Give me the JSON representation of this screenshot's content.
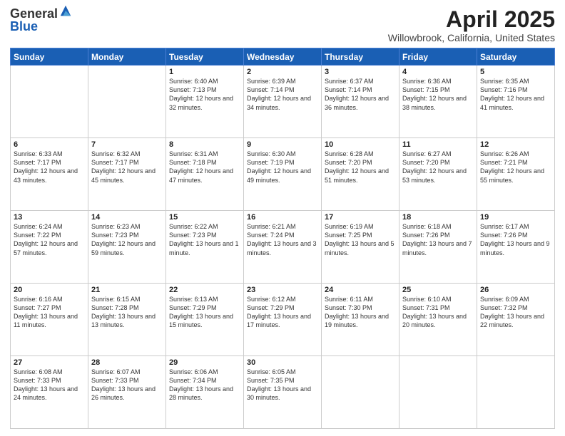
{
  "logo": {
    "general": "General",
    "blue": "Blue"
  },
  "header": {
    "title": "April 2025",
    "subtitle": "Willowbrook, California, United States"
  },
  "weekdays": [
    "Sunday",
    "Monday",
    "Tuesday",
    "Wednesday",
    "Thursday",
    "Friday",
    "Saturday"
  ],
  "weeks": [
    [
      {
        "day": "",
        "info": ""
      },
      {
        "day": "",
        "info": ""
      },
      {
        "day": "1",
        "info": "Sunrise: 6:40 AM\nSunset: 7:13 PM\nDaylight: 12 hours\nand 32 minutes."
      },
      {
        "day": "2",
        "info": "Sunrise: 6:39 AM\nSunset: 7:14 PM\nDaylight: 12 hours\nand 34 minutes."
      },
      {
        "day": "3",
        "info": "Sunrise: 6:37 AM\nSunset: 7:14 PM\nDaylight: 12 hours\nand 36 minutes."
      },
      {
        "day": "4",
        "info": "Sunrise: 6:36 AM\nSunset: 7:15 PM\nDaylight: 12 hours\nand 38 minutes."
      },
      {
        "day": "5",
        "info": "Sunrise: 6:35 AM\nSunset: 7:16 PM\nDaylight: 12 hours\nand 41 minutes."
      }
    ],
    [
      {
        "day": "6",
        "info": "Sunrise: 6:33 AM\nSunset: 7:17 PM\nDaylight: 12 hours\nand 43 minutes."
      },
      {
        "day": "7",
        "info": "Sunrise: 6:32 AM\nSunset: 7:17 PM\nDaylight: 12 hours\nand 45 minutes."
      },
      {
        "day": "8",
        "info": "Sunrise: 6:31 AM\nSunset: 7:18 PM\nDaylight: 12 hours\nand 47 minutes."
      },
      {
        "day": "9",
        "info": "Sunrise: 6:30 AM\nSunset: 7:19 PM\nDaylight: 12 hours\nand 49 minutes."
      },
      {
        "day": "10",
        "info": "Sunrise: 6:28 AM\nSunset: 7:20 PM\nDaylight: 12 hours\nand 51 minutes."
      },
      {
        "day": "11",
        "info": "Sunrise: 6:27 AM\nSunset: 7:20 PM\nDaylight: 12 hours\nand 53 minutes."
      },
      {
        "day": "12",
        "info": "Sunrise: 6:26 AM\nSunset: 7:21 PM\nDaylight: 12 hours\nand 55 minutes."
      }
    ],
    [
      {
        "day": "13",
        "info": "Sunrise: 6:24 AM\nSunset: 7:22 PM\nDaylight: 12 hours\nand 57 minutes."
      },
      {
        "day": "14",
        "info": "Sunrise: 6:23 AM\nSunset: 7:23 PM\nDaylight: 12 hours\nand 59 minutes."
      },
      {
        "day": "15",
        "info": "Sunrise: 6:22 AM\nSunset: 7:23 PM\nDaylight: 13 hours\nand 1 minute."
      },
      {
        "day": "16",
        "info": "Sunrise: 6:21 AM\nSunset: 7:24 PM\nDaylight: 13 hours\nand 3 minutes."
      },
      {
        "day": "17",
        "info": "Sunrise: 6:19 AM\nSunset: 7:25 PM\nDaylight: 13 hours\nand 5 minutes."
      },
      {
        "day": "18",
        "info": "Sunrise: 6:18 AM\nSunset: 7:26 PM\nDaylight: 13 hours\nand 7 minutes."
      },
      {
        "day": "19",
        "info": "Sunrise: 6:17 AM\nSunset: 7:26 PM\nDaylight: 13 hours\nand 9 minutes."
      }
    ],
    [
      {
        "day": "20",
        "info": "Sunrise: 6:16 AM\nSunset: 7:27 PM\nDaylight: 13 hours\nand 11 minutes."
      },
      {
        "day": "21",
        "info": "Sunrise: 6:15 AM\nSunset: 7:28 PM\nDaylight: 13 hours\nand 13 minutes."
      },
      {
        "day": "22",
        "info": "Sunrise: 6:13 AM\nSunset: 7:29 PM\nDaylight: 13 hours\nand 15 minutes."
      },
      {
        "day": "23",
        "info": "Sunrise: 6:12 AM\nSunset: 7:29 PM\nDaylight: 13 hours\nand 17 minutes."
      },
      {
        "day": "24",
        "info": "Sunrise: 6:11 AM\nSunset: 7:30 PM\nDaylight: 13 hours\nand 19 minutes."
      },
      {
        "day": "25",
        "info": "Sunrise: 6:10 AM\nSunset: 7:31 PM\nDaylight: 13 hours\nand 20 minutes."
      },
      {
        "day": "26",
        "info": "Sunrise: 6:09 AM\nSunset: 7:32 PM\nDaylight: 13 hours\nand 22 minutes."
      }
    ],
    [
      {
        "day": "27",
        "info": "Sunrise: 6:08 AM\nSunset: 7:33 PM\nDaylight: 13 hours\nand 24 minutes."
      },
      {
        "day": "28",
        "info": "Sunrise: 6:07 AM\nSunset: 7:33 PM\nDaylight: 13 hours\nand 26 minutes."
      },
      {
        "day": "29",
        "info": "Sunrise: 6:06 AM\nSunset: 7:34 PM\nDaylight: 13 hours\nand 28 minutes."
      },
      {
        "day": "30",
        "info": "Sunrise: 6:05 AM\nSunset: 7:35 PM\nDaylight: 13 hours\nand 30 minutes."
      },
      {
        "day": "",
        "info": ""
      },
      {
        "day": "",
        "info": ""
      },
      {
        "day": "",
        "info": ""
      }
    ]
  ]
}
